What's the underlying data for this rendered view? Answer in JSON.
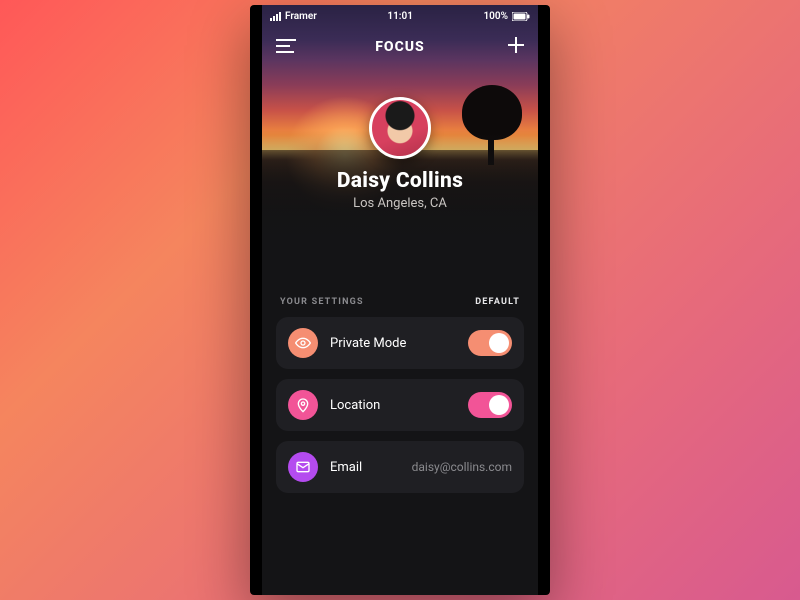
{
  "statusbar": {
    "carrier": "Framer",
    "time": "11:01",
    "battery": "100%"
  },
  "navbar": {
    "title": "FOCUS"
  },
  "profile": {
    "name": "Daisy Collins",
    "location": "Los Angeles, CA"
  },
  "settings": {
    "section_label": "YOUR SETTINGS",
    "section_action": "DEFAULT",
    "rows": [
      {
        "label": "Private Mode",
        "icon": "eye",
        "color": "orange",
        "toggle_on": true
      },
      {
        "label": "Location",
        "icon": "pin",
        "color": "pink",
        "toggle_on": true
      },
      {
        "label": "Email",
        "icon": "mail",
        "color": "purple",
        "value": "daisy@collins.com"
      }
    ]
  }
}
